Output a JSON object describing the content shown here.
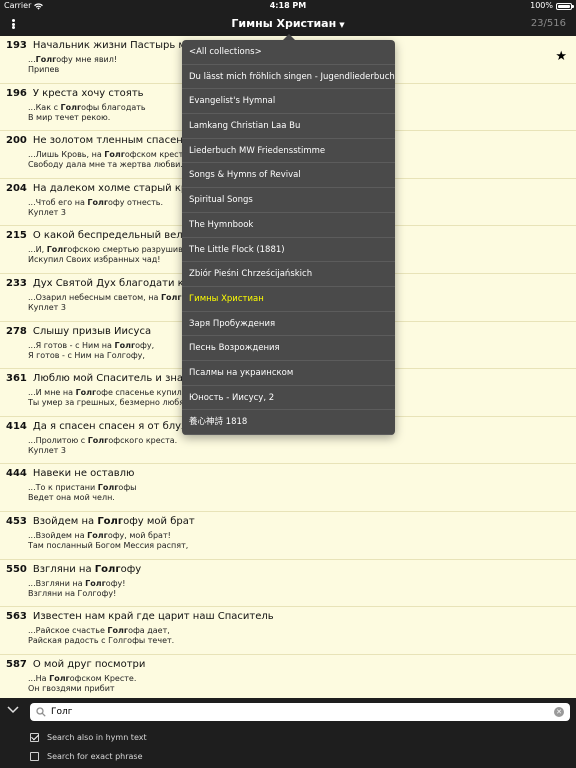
{
  "status_bar": {
    "carrier": "Carrier",
    "time": "4:18 PM",
    "battery": "100%",
    "battery_level": 1.0
  },
  "nav": {
    "title": "Гимны Христиан",
    "count": "23/516"
  },
  "hymns": [
    {
      "number": "193",
      "title": [
        [
          "Начальник жизни Пастырь мой",
          false
        ]
      ],
      "line1": [
        [
          "...",
          false
        ],
        [
          "Голг",
          true
        ],
        [
          "офу мне явил!",
          false
        ]
      ],
      "line2": [
        [
          "Припев",
          false
        ]
      ],
      "starred": true
    },
    {
      "number": "196",
      "title": [
        [
          "У креста хочу стоять",
          false
        ]
      ],
      "line1": [
        [
          "...Как с ",
          false
        ],
        [
          "Голг",
          true
        ],
        [
          "офы благодать",
          false
        ]
      ],
      "line2": [
        [
          "В мир течет рекою.",
          false
        ]
      ],
      "starred": false
    },
    {
      "number": "200",
      "title": [
        [
          "Не золотом тленным спасен я от а",
          false
        ]
      ],
      "line1": [
        [
          "...Лишь Кровь, на ",
          false
        ],
        [
          "Голг",
          true
        ],
        [
          "офском кресте",
          false
        ]
      ],
      "line2": [
        [
          "Свободу дала мне та жертва любви.",
          false
        ]
      ],
      "starred": false
    },
    {
      "number": "204",
      "title": [
        [
          "На далеком холме старый крест в",
          false
        ]
      ],
      "line1": [
        [
          "...Чтоб его на ",
          false
        ],
        [
          "Голг",
          true
        ],
        [
          "офу отнесть.",
          false
        ]
      ],
      "line2": [
        [
          "Куплет 3",
          false
        ]
      ],
      "starred": false
    },
    {
      "number": "215",
      "title": [
        [
          "О какой беспредельный великий",
          false
        ]
      ],
      "line1": [
        [
          "...И, ",
          false
        ],
        [
          "Голг",
          true
        ],
        [
          "офскою смертью разрушивш",
          false
        ]
      ],
      "line2": [
        [
          "Искупил Своих избранных чад!",
          false
        ]
      ],
      "starred": false
    },
    {
      "number": "233",
      "title": [
        [
          "Дух Святой Дух благодати к нам п",
          false
        ]
      ],
      "line1": [
        [
          "...Озарил небесным светом, на ",
          false
        ],
        [
          "Голг",
          true
        ],
        [
          "оф",
          false
        ]
      ],
      "line2": [
        [
          "Куплет 3",
          false
        ]
      ],
      "starred": false
    },
    {
      "number": "278",
      "title": [
        [
          "Слышу призыв Иисуса",
          false
        ]
      ],
      "line1": [
        [
          "...Я готов - с Ним на ",
          false
        ],
        [
          "Голг",
          true
        ],
        [
          "офу,",
          false
        ]
      ],
      "line2": [
        [
          "Я готов - с Ним на Голгофу,",
          false
        ]
      ],
      "starred": false
    },
    {
      "number": "361",
      "title": [
        [
          "Люблю мой Спаситель и знаю Ты",
          false
        ]
      ],
      "line1": [
        [
          "...И мне на ",
          false
        ],
        [
          "Голг",
          true
        ],
        [
          "офе спасенье купил.",
          false
        ]
      ],
      "line2": [
        [
          "Ты умер за грешных, безмерно любя.",
          false
        ]
      ],
      "starred": false
    },
    {
      "number": "414",
      "title": [
        [
          "Да я спасен спасен я от блуждани",
          false
        ]
      ],
      "line1": [
        [
          "...Пролитою с ",
          false
        ],
        [
          "Голг",
          true
        ],
        [
          "офского креста.",
          false
        ]
      ],
      "line2": [
        [
          "Куплет 3",
          false
        ]
      ],
      "starred": false
    },
    {
      "number": "444",
      "title": [
        [
          "Навеки не оставлю",
          false
        ]
      ],
      "line1": [
        [
          "...То к пристани ",
          false
        ],
        [
          "Голг",
          true
        ],
        [
          "офы",
          false
        ]
      ],
      "line2": [
        [
          "Ведет она мой челн.",
          false
        ]
      ],
      "starred": false
    },
    {
      "number": "453",
      "title": [
        [
          "Взойдем на ",
          false
        ],
        [
          "Голг",
          true
        ],
        [
          "офу мой брат",
          false
        ]
      ],
      "line1": [
        [
          "...Взойдем на ",
          false
        ],
        [
          "Голг",
          true
        ],
        [
          "офу, мой брат!",
          false
        ]
      ],
      "line2": [
        [
          "Там посланный Богом Мессия распят,",
          false
        ]
      ],
      "starred": false
    },
    {
      "number": "550",
      "title": [
        [
          "Взгляни на ",
          false
        ],
        [
          "Голг",
          true
        ],
        [
          "офу",
          false
        ]
      ],
      "line1": [
        [
          "...Взгляни на ",
          false
        ],
        [
          "Голг",
          true
        ],
        [
          "офу!",
          false
        ]
      ],
      "line2": [
        [
          "Взгляни на Голгофу!",
          false
        ]
      ],
      "starred": false
    },
    {
      "number": "563",
      "title": [
        [
          "Известен нам край где царит наш Спаситель",
          false
        ]
      ],
      "line1": [
        [
          "...Райское счастье ",
          false
        ],
        [
          "Голг",
          true
        ],
        [
          "офа дает,",
          false
        ]
      ],
      "line2": [
        [
          "Райская радость с Голгофы течет.",
          false
        ]
      ],
      "starred": false
    },
    {
      "number": "587",
      "title": [
        [
          "О мой друг посмотри",
          false
        ]
      ],
      "line1": [
        [
          "...На ",
          false
        ],
        [
          "Голг",
          true
        ],
        [
          "офском Кресте.",
          false
        ]
      ],
      "line2": [
        [
          "Он гвоздями прибит",
          false
        ]
      ],
      "starred": false
    }
  ],
  "collections": [
    {
      "label": "<All collections>",
      "selected": false
    },
    {
      "label": "Du lässt mich fröhlich singen - Jugendliederbuch",
      "selected": false
    },
    {
      "label": "Evangelist's Hymnal",
      "selected": false
    },
    {
      "label": "Lamkang Christian Laa Bu",
      "selected": false
    },
    {
      "label": "Liederbuch MW Friedensstimme",
      "selected": false
    },
    {
      "label": "Songs & Hymns of Revival",
      "selected": false
    },
    {
      "label": "Spiritual Songs",
      "selected": false
    },
    {
      "label": "The Hymnbook",
      "selected": false
    },
    {
      "label": "The Little Flock (1881)",
      "selected": false
    },
    {
      "label": "Zbiór Pieśni Chrześcijańskich",
      "selected": false
    },
    {
      "label": "Гимны Христиан",
      "selected": true
    },
    {
      "label": "Заря Пробуждения",
      "selected": false
    },
    {
      "label": "Песнь Возрождения",
      "selected": false
    },
    {
      "label": "Псалмы на украинском",
      "selected": false
    },
    {
      "label": "Юность - Иисусу, 2",
      "selected": false
    },
    {
      "label": "養心神詩 1818",
      "selected": false
    }
  ],
  "search": {
    "value": "Голг",
    "placeholder": ""
  },
  "options": {
    "hymn_text": {
      "label": "Search also in hymn text",
      "checked": true
    },
    "exact_phrase": {
      "label": "Search for exact phrase",
      "checked": false
    }
  },
  "colors": {
    "bar": "#1e1e1e",
    "list_bg": "#fdfbe0",
    "dropdown_bg": "#4a4a4a",
    "selected_text": "#ffff00"
  }
}
